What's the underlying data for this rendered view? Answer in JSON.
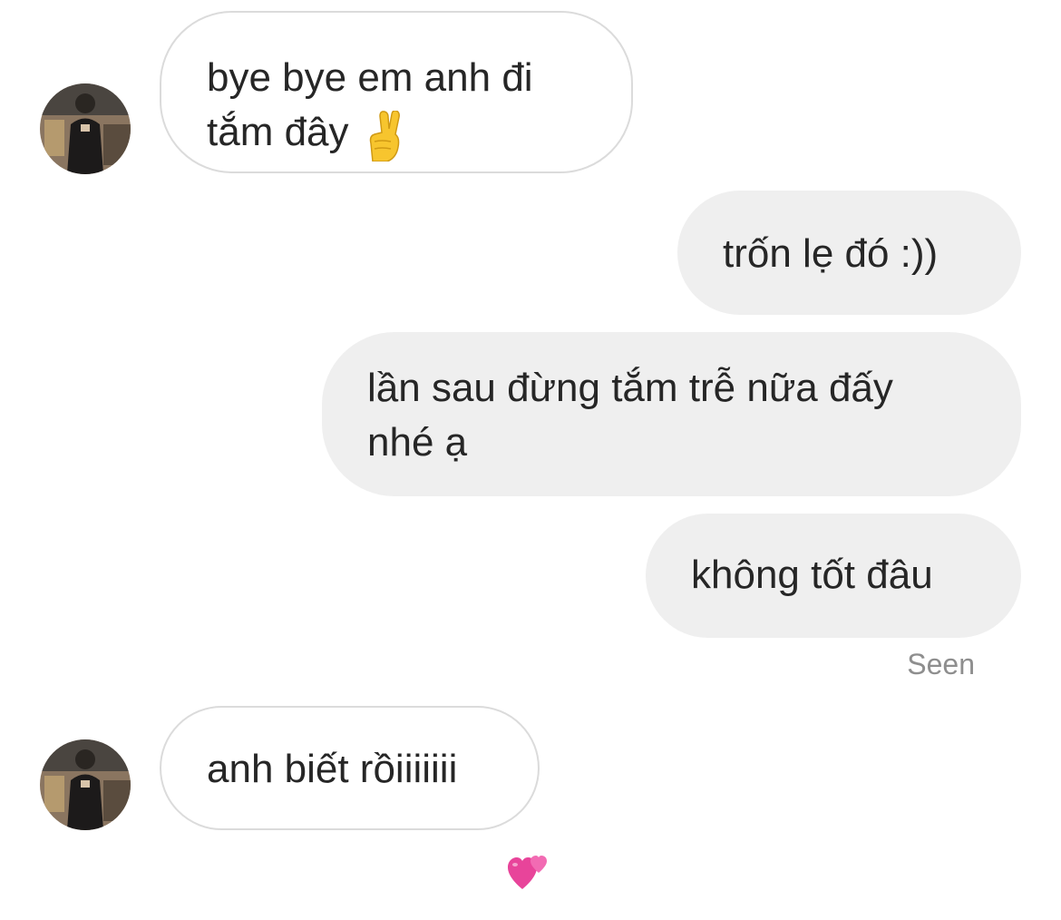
{
  "thread": {
    "messages": [
      {
        "sender": "them",
        "lines": [
          "bye bye em anh đi",
          "tắm đây"
        ],
        "emoji": "crossed-fingers"
      },
      {
        "sender": "me",
        "lines": [
          "trốn lẹ đó :))"
        ]
      },
      {
        "sender": "me",
        "lines": [
          "lần sau đừng tắm trễ nữa đấy",
          "nhé ạ"
        ]
      },
      {
        "sender": "me",
        "lines": [
          "không tốt đâu"
        ]
      },
      {
        "sender": "them",
        "lines": [
          "anh biết rồiiiiiii"
        ],
        "reaction": "two-hearts"
      }
    ],
    "seen_label": "Seen"
  },
  "colors": {
    "outgoing_bubble": "#efefef",
    "incoming_border": "#dbdbdb",
    "text": "#262626",
    "seen_text": "#8e8e8e",
    "heart": "#e8449a"
  }
}
